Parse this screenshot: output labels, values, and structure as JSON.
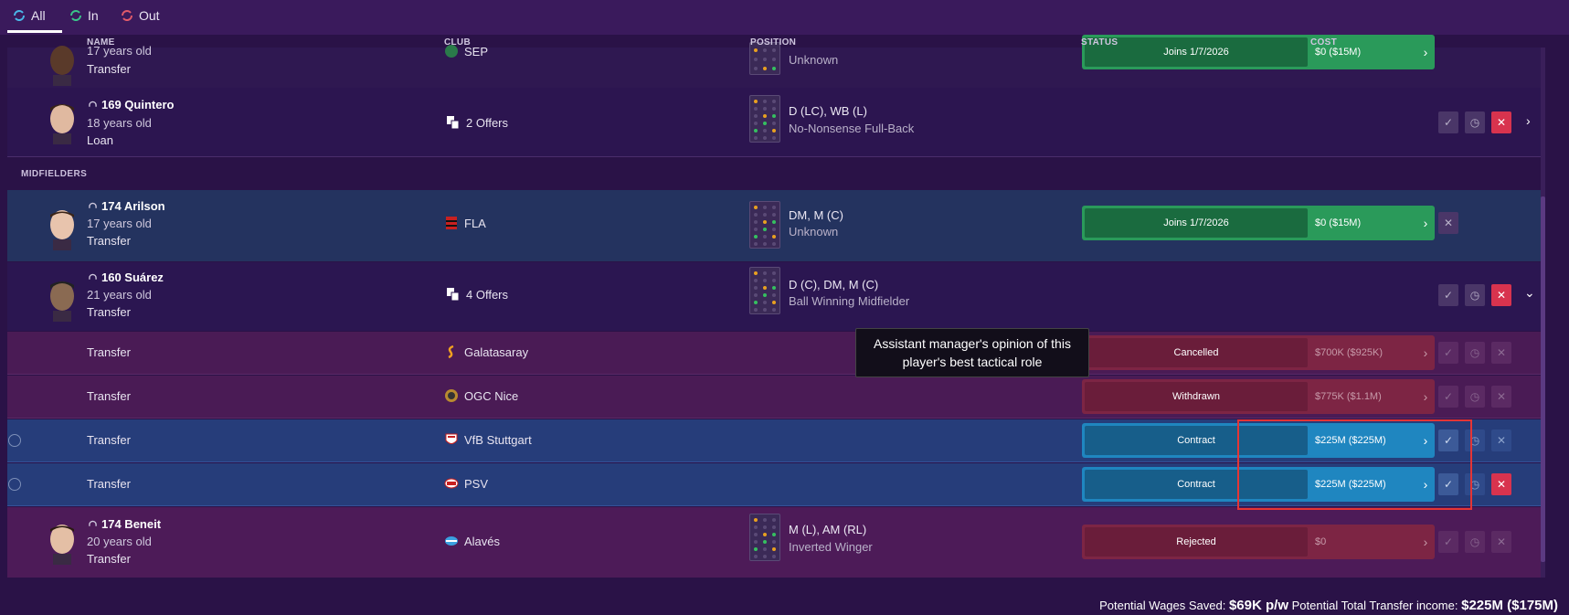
{
  "tabs": [
    {
      "label": "All",
      "color": "#4ab6e8"
    },
    {
      "label": "In",
      "color": "#3ac48a"
    },
    {
      "label": "Out",
      "color": "#e05a6a"
    }
  ],
  "columns": {
    "name": "NAME",
    "club": "CLUB",
    "position": "POSITION",
    "status": "STATUS",
    "cost": "COST"
  },
  "section_midfielders": "MIDFIELDERS",
  "players": {
    "top": {
      "age": "17 years old",
      "deal": "Transfer",
      "club": "SEP",
      "pos1": "Unknown",
      "status": "Joins 1/7/2026",
      "cost": "$0 ($15M)"
    },
    "quintero": {
      "name": "169 Quintero",
      "age": "18 years old",
      "deal": "Loan",
      "offers": "2 Offers",
      "pos1": "D (LC), WB (L)",
      "pos2": "No-Nonsense Full-Back"
    },
    "arilson": {
      "name": "174 Arilson",
      "age": "17 years old",
      "deal": "Transfer",
      "club": "FLA",
      "pos1": "DM, M (C)",
      "pos2": "Unknown",
      "status": "Joins 1/7/2026",
      "cost": "$0 ($15M)"
    },
    "suarez": {
      "name": "160 Suárez",
      "age": "21 years old",
      "deal": "Transfer",
      "offers": "4 Offers",
      "pos1": "D (C), DM, M (C)",
      "pos2": "Ball Winning Midfielder"
    },
    "beneit": {
      "name": "174 Beneit",
      "age": "20 years old",
      "deal": "Transfer",
      "club": "Alavés",
      "pos1": "M (L), AM (RL)",
      "pos2": "Inverted Winger",
      "status": "Rejected",
      "cost": "$0"
    }
  },
  "offers": [
    {
      "deal": "Transfer",
      "club": "Galatasaray",
      "status": "Cancelled",
      "cost": "$700K ($925K)"
    },
    {
      "deal": "Transfer",
      "club": "OGC Nice",
      "status": "Withdrawn",
      "cost": "$775K ($1.1M)"
    },
    {
      "deal": "Transfer",
      "club": "VfB Stuttgart",
      "status": "Contract",
      "cost": "$225M ($225M)"
    },
    {
      "deal": "Transfer",
      "club": "PSV",
      "status": "Contract",
      "cost": "$225M ($225M)"
    }
  ],
  "tooltip": "Assistant manager's opinion of this player's best tactical role",
  "footer": {
    "wages_label": "Potential Wages Saved:",
    "wages_value": "$69K p/w",
    "income_label": "Potential Total Transfer income:",
    "income_value": "$225M ($175M)"
  }
}
